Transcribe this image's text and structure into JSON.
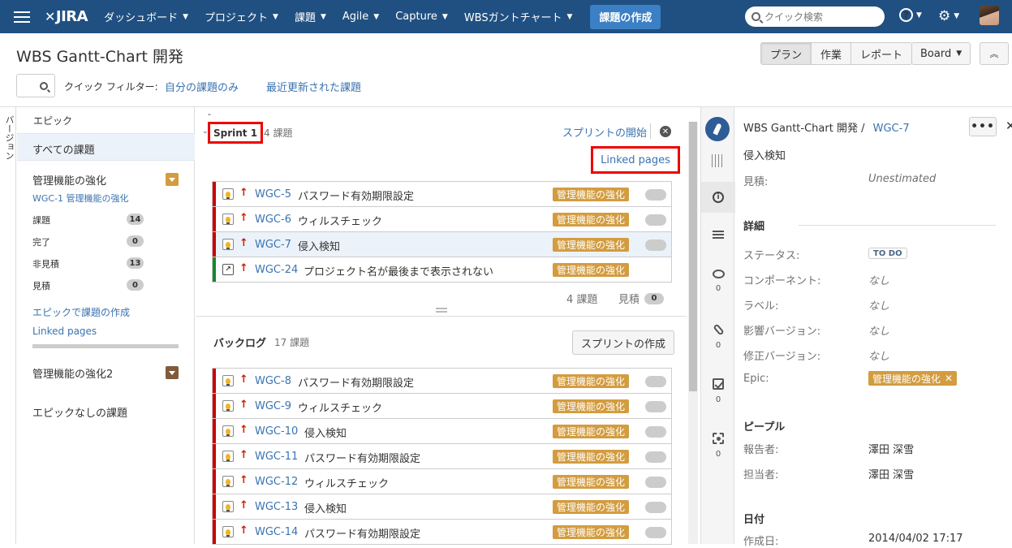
{
  "topnav": {
    "logo": "JIRA",
    "menus": [
      {
        "label": "ダッシュボード"
      },
      {
        "label": "プロジェクト"
      },
      {
        "label": "課題"
      },
      {
        "label": "Agile"
      },
      {
        "label": "Capture"
      },
      {
        "label": "WBSガントチャート"
      }
    ],
    "create_label": "課題の作成",
    "search_placeholder": "クイック検索",
    "icons": [
      "menu-icon",
      "help-icon",
      "gear-icon",
      "avatar"
    ]
  },
  "header": {
    "title": "WBS Gantt-Chart 開発",
    "view_buttons": [
      "プラン",
      "作業",
      "レポート"
    ],
    "board_label": "Board",
    "quick_filter_label": "クイック フィルター:",
    "quick_filters": [
      "自分の課題のみ",
      "最近更新された課題"
    ]
  },
  "version_strip": {
    "label": "バージョン"
  },
  "epics": {
    "title": "エピック",
    "all_issues": "すべての課題",
    "epic1": {
      "name": "管理機能の強化",
      "key_line": "WGC-1 管理機能の強化",
      "stats": [
        {
          "label": "課題",
          "count": "14"
        },
        {
          "label": "完了",
          "count": "0"
        },
        {
          "label": "非見積",
          "count": "13"
        },
        {
          "label": "見積",
          "count": "0"
        }
      ],
      "create_link": "エピックで課題の作成",
      "linked_pages": "Linked pages",
      "color": "#d39c3f"
    },
    "epic2": {
      "name": "管理機能の強化2",
      "color": "#815b3a"
    },
    "no_epic": "エピックなしの課題"
  },
  "sprint": {
    "dash": "-",
    "name": "Sprint 1",
    "count_label": "4 課題",
    "start_label": "スプリントの開始",
    "linked_pages": "Linked pages",
    "issues": [
      {
        "key": "WGC-5",
        "summary": "パスワード有効期限設定",
        "epic": "管理機能の強化"
      },
      {
        "key": "WGC-6",
        "summary": "ウィルスチェック",
        "epic": "管理機能の強化"
      },
      {
        "key": "WGC-7",
        "summary": "侵入検知",
        "epic": "管理機能の強化"
      },
      {
        "key": "WGC-24",
        "summary": "プロジェクト名が最後まで表示されない",
        "epic": "管理機能の強化"
      }
    ],
    "footer_count": "4 課題",
    "footer_estimate_label": "見積",
    "footer_estimate_value": "0"
  },
  "backlog": {
    "title": "バックログ",
    "count_label": "17 課題",
    "create_sprint": "スプリントの作成",
    "issues": [
      {
        "key": "WGC-8",
        "summary": "パスワード有効期限設定",
        "epic": "管理機能の強化"
      },
      {
        "key": "WGC-9",
        "summary": "ウィルスチェック",
        "epic": "管理機能の強化"
      },
      {
        "key": "WGC-10",
        "summary": "侵入検知",
        "epic": "管理機能の強化"
      },
      {
        "key": "WGC-11",
        "summary": "パスワード有効期限設定",
        "epic": "管理機能の強化"
      },
      {
        "key": "WGC-12",
        "summary": "ウィルスチェック",
        "epic": "管理機能の強化"
      },
      {
        "key": "WGC-13",
        "summary": "侵入検知",
        "epic": "管理機能の強化"
      },
      {
        "key": "WGC-14",
        "summary": "パスワード有効期限設定",
        "epic": "管理機能の強化"
      }
    ]
  },
  "detail_icons": {
    "comments": "0",
    "attachments": "0",
    "subtasks": "0",
    "screenshots": "0"
  },
  "detail": {
    "crumb_project": "WBS Gantt-Chart 開発",
    "crumb_sep": "/",
    "crumb_key": "WGC-7",
    "more_label": "•••",
    "summary": "侵入検知",
    "estimate_label": "見積:",
    "estimate_value": "Unestimated",
    "section_details": "詳細",
    "status_label": "ステータス:",
    "status_value": "TO DO",
    "component_label": "コンポーネント:",
    "component_value": "なし",
    "labels_label": "ラベル:",
    "labels_value": "なし",
    "affects_label": "影響バージョン:",
    "affects_value": "なし",
    "fix_label": "修正バージョン:",
    "fix_value": "なし",
    "epic_label": "Epic:",
    "epic_value": "管理機能の強化",
    "section_people": "ピープル",
    "reporter_label": "報告者:",
    "reporter_value": "澤田 深雪",
    "assignee_label": "担当者:",
    "assignee_value": "澤田 深雪",
    "section_dates": "日付",
    "created_label": "作成日:",
    "created_value": "2014/04/02 17:17"
  }
}
